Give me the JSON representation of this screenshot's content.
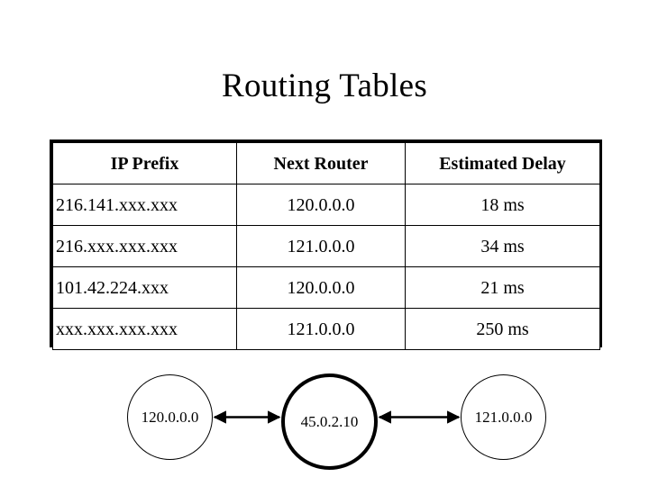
{
  "slide": {
    "title": "Routing Tables"
  },
  "table": {
    "headers": {
      "prefix": "IP Prefix",
      "router": "Next Router",
      "delay": "Estimated Delay"
    },
    "rows": [
      {
        "prefix": "216.141.xxx.xxx",
        "router": "120.0.0.0",
        "delay": "18 ms"
      },
      {
        "prefix": "216.xxx.xxx.xxx",
        "router": "121.0.0.0",
        "delay": "34 ms"
      },
      {
        "prefix": "101.42.224.xxx",
        "router": "120.0.0.0",
        "delay": "21 ms"
      },
      {
        "prefix": "xxx.xxx.xxx.xxx",
        "router": "121.0.0.0",
        "delay": "250 ms"
      }
    ]
  },
  "diagram": {
    "nodes": [
      {
        "label": "120.0.0.0",
        "emphasis": "thin"
      },
      {
        "label": "45.0.2.10",
        "emphasis": "thick"
      },
      {
        "label": "121.0.0.0",
        "emphasis": "thin"
      }
    ],
    "links": [
      {
        "from": "120.0.0.0",
        "to": "45.0.2.10",
        "style": "double-arrow"
      },
      {
        "from": "45.0.2.10",
        "to": "121.0.0.0",
        "style": "double-arrow"
      }
    ]
  },
  "colors": {
    "background": "#ffffff",
    "foreground": "#000000",
    "table_border": "#000000"
  }
}
